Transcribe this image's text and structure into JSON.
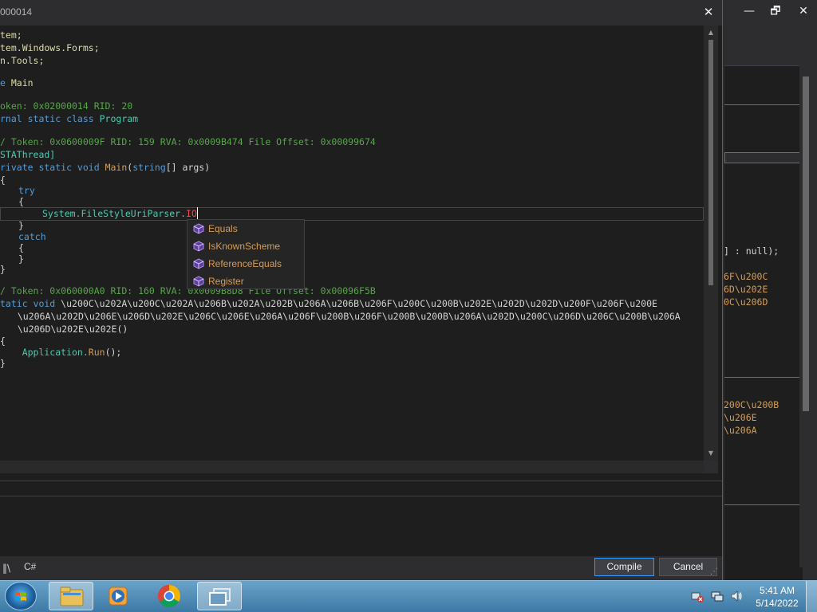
{
  "dialog": {
    "title": "000014",
    "close_glyph": "✕"
  },
  "background_window": {
    "minimize_glyph": "—",
    "restore_glyph": "🗗",
    "close_glyph": "✕",
    "fragments": [
      "] : null);",
      "6F\\u200C",
      "6D\\u202E",
      "0C\\u206D",
      "200C\\u200B",
      "\\u206E",
      "\\u206A"
    ]
  },
  "code": {
    "l1": "tem;",
    "l2": "tem.Windows.Forms;",
    "l3": "n.Tools;",
    "l4_kw": "e",
    "l4_name": " Main",
    "l5": "oken: 0x02000014 RID: 20",
    "l6_kw": "rnal static class ",
    "l6_type": "Program",
    "l7": "/ Token: 0x0600009F RID: 159 RVA: 0x0009B474 File Offset: 0x00099674",
    "l8": "STAThread]",
    "l9_kw": "rivate static void ",
    "l9_method": "Main",
    "l9_rest1": "(",
    "l9_kw2": "string",
    "l9_rest2": "[] args)",
    "l10": "{",
    "l11_kw": "try",
    "l12": "{",
    "l13_a": "System.FileStyleUriParser.",
    "l13_b": "IO",
    "l14": "}",
    "l15_kw": "catch",
    "l16": "{",
    "l17": "}",
    "l18": "}",
    "l19": "/ Token: 0x060000A0 RID: 160 RVA: 0x0009B8D8 File Offset: 0x00096F5B",
    "l20_kw": "tatic void ",
    "l20_rest": "\\u200C\\u202A\\u200C\\u202A\\u206B\\u202A\\u202B\\u206A\\u206B\\u206F\\u200C\\u200B\\u202E\\u202D\\u202D\\u200F\\u206F\\u200E",
    "l21": "  \\u206A\\u202D\\u206E\\u206D\\u202E\\u206C\\u206E\\u206A\\u206F\\u200B\\u206F\\u200B\\u200B\\u206A\\u202D\\u200C\\u206D\\u206C\\u200B\\u206A",
    "l22": "  \\u206D\\u202E\\u202E()",
    "l23": "{",
    "l24_a": "    Application.",
    "l24_b": "Run",
    "l24_c": "();",
    "l25": "}"
  },
  "autocomplete": {
    "items": [
      "Equals",
      "IsKnownScheme",
      "ReferenceEquals",
      "Register"
    ]
  },
  "footer": {
    "lib_glyph": "‖\\",
    "language": "C#",
    "compile_label": "Compile",
    "cancel_label": "Cancel",
    "grip_glyph": "⋰"
  },
  "taskbar": {
    "time": "5:41 AM",
    "date": "5/14/2022"
  },
  "colors": {
    "accent": "#3399ff",
    "method": "#d69d54",
    "keyword": "#569cd6",
    "comment": "#57a64a"
  }
}
